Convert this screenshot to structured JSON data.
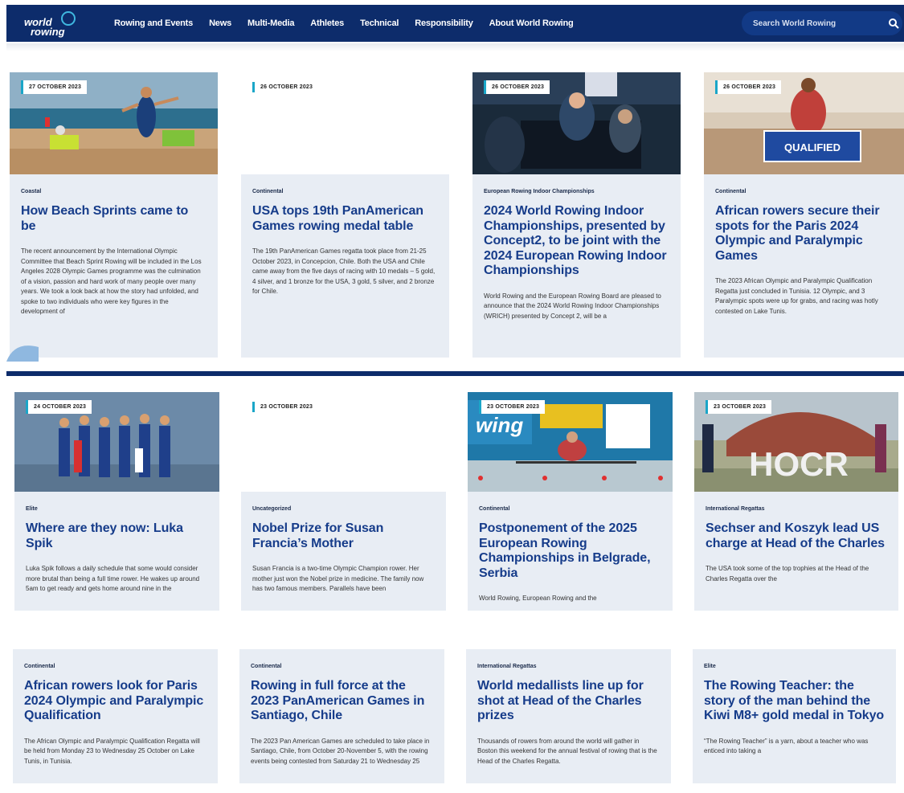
{
  "nav": {
    "logo_line1": "world",
    "logo_line2": "rowing",
    "links": [
      "Rowing and Events",
      "News",
      "Multi-Media",
      "Athletes",
      "Technical",
      "Responsibility",
      "About World Rowing"
    ],
    "search_placeholder": "Search World Rowing"
  },
  "cards": [
    {
      "date": "27 OCTOBER 2023",
      "category": "Coastal",
      "title": "How Beach Sprints came to be",
      "excerpt": "The recent announcement by the International Olympic Committee that Beach Sprint Rowing will be included in the Los Angeles 2028 Olympic Games programme was the culmination of a vision, passion and hard work of many people over many years. We took a look back at how the story had unfolded, and spoke to two individuals who were key figures in the development of"
    },
    {
      "date": "26 OCTOBER 2023",
      "category": "Continental",
      "title": "USA tops 19th PanAmerican Games rowing medal table",
      "excerpt": "The 19th PanAmerican Games regatta took place from 21-25 October 2023, in Concepcion, Chile. Both the USA and Chile came away from the five days of racing with 10 medals – 5 gold, 4 silver, and 1 bronze for the USA, 3 gold, 5 silver, and 2 bronze for Chile."
    },
    {
      "date": "26 OCTOBER 2023",
      "category": "European Rowing Indoor Championships",
      "title": "2024 World Rowing Indoor Championships, presented by Concept2, to be joint with the 2024 European Rowing Indoor Championships",
      "excerpt": "World Rowing and the European Rowing Board are pleased to announce that the 2024 World Rowing Indoor Championships (WRICH) presented by Concept 2, will be a"
    },
    {
      "date": "26 OCTOBER 2023",
      "category": "Continental",
      "title": "African rowers secure their spots for the Paris 2024 Olympic and Paralympic Games",
      "excerpt": "The 2023 African Olympic and Paralympic Qualification Regatta just concluded in Tunisia. 12 Olympic, and 3 Paralympic spots were up for grabs, and racing was hotly contested on Lake Tunis."
    },
    {
      "date": "24 OCTOBER 2023",
      "category": "Elite",
      "title": "Where are they now: Luka Spik",
      "excerpt": "Luka Spik follows a daily schedule that some would consider more brutal than being a full time rower. He wakes up around 5am to get ready and gets home around nine in the"
    },
    {
      "date": "23 OCTOBER 2023",
      "category": "Uncategorized",
      "title": "Nobel Prize for Susan Francia’s Mother",
      "excerpt": "Susan Francia is a two-time Olympic Champion rower. Her mother just won the Nobel prize in medicine. The family now has two famous members. Parallels have been"
    },
    {
      "date": "23 OCTOBER 2023",
      "category": "Continental",
      "title": "Postponement of the 2025 European Rowing Championships in Belgrade, Serbia",
      "excerpt": "World Rowing, European Rowing and the"
    },
    {
      "date": "23 OCTOBER 2023",
      "category": "International Regattas",
      "title": "Sechser and Koszyk lead US charge at Head of the Charles",
      "excerpt": "The USA took some of the top trophies at the Head of the Charles Regatta over the"
    },
    {
      "date": "",
      "category": "Continental",
      "title": "African rowers look for Paris 2024 Olympic and Paralympic Qualification",
      "excerpt": "The African Olympic and Paralympic Qualification Regatta will be held from Monday 23 to Wednesday 25 October on Lake Tunis, in Tunisia."
    },
    {
      "date": "",
      "category": "Continental",
      "title": "Rowing in full force at the 2023 PanAmerican Games in Santiago, Chile",
      "excerpt": "The 2023 Pan American Games are scheduled to take place in Santiago, Chile, from October 20-November 5, with the rowing events being contested from Saturday 21 to Wednesday 25"
    },
    {
      "date": "",
      "category": "International Regattas",
      "title": "World medallists line up for shot at Head of the Charles prizes",
      "excerpt": "Thousands of rowers from around the world will gather in Boston this weekend for the annual festival of rowing that is the Head of the Charles Regatta."
    },
    {
      "date": "",
      "category": "Elite",
      "title": "The Rowing Teacher: the story of the man behind the Kiwi M8+ gold medal in Tokyo",
      "excerpt": "“The Rowing Teacher” is a yarn, about a teacher who was enticed into taking a"
    }
  ]
}
